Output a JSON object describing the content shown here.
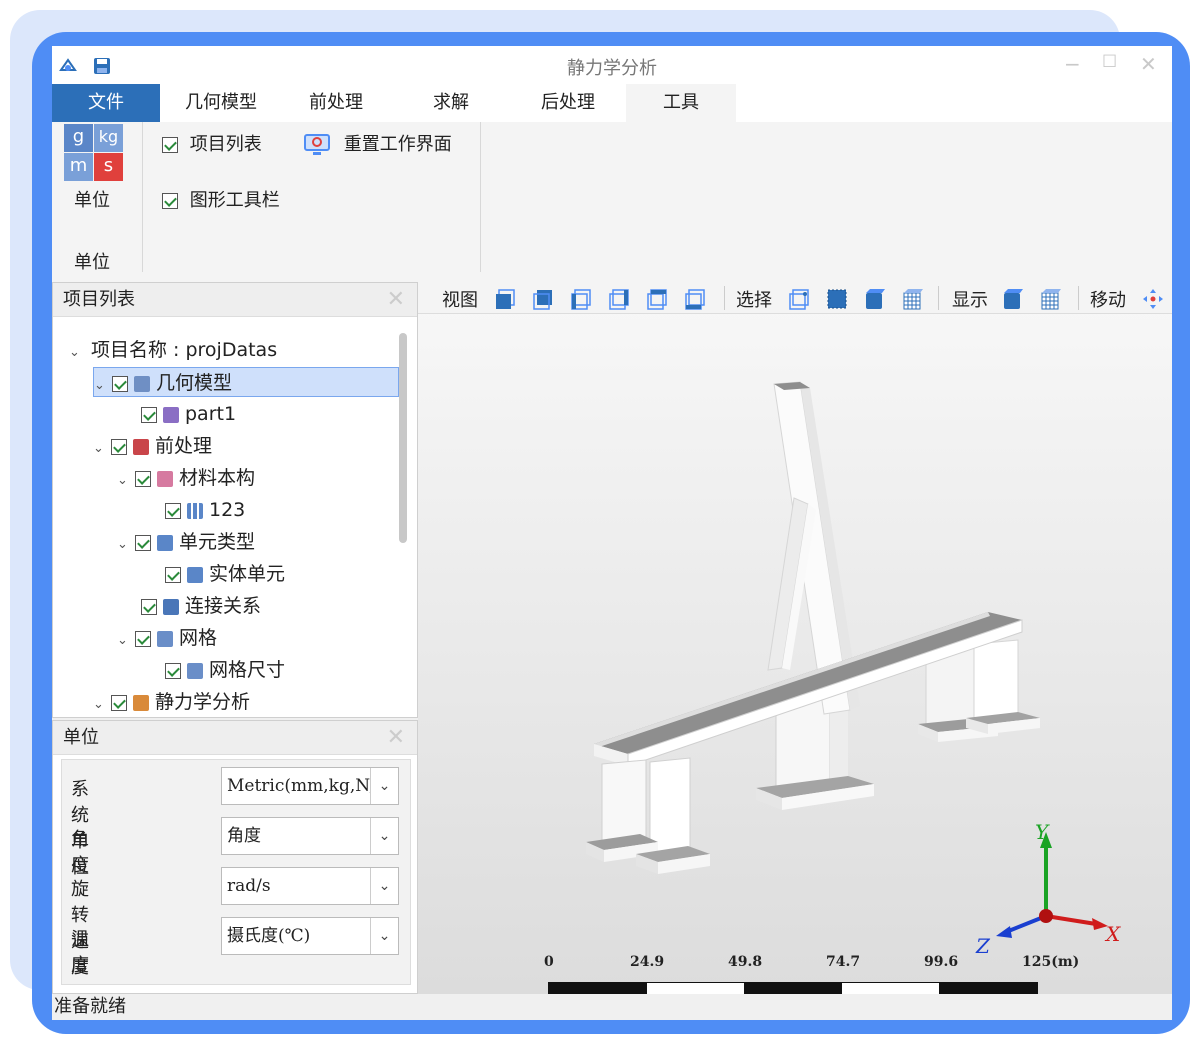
{
  "window": {
    "title": "静力学分析"
  },
  "ribbon_tabs": [
    "文件",
    "几何模型",
    "前处理",
    "求解",
    "后处理",
    "工具"
  ],
  "ribbon": {
    "units_icon_letters": [
      "g",
      "kg",
      "m",
      "s"
    ],
    "units_button_label": "单位",
    "units_group_label": "单位",
    "check_project_list": "项目列表",
    "check_graphic_toolbar": "图形工具栏",
    "reset_workspace": "重置工作界面"
  },
  "project_panel": {
    "title": "项目列表",
    "tree": [
      {
        "label": "项目名称 : projDatas"
      },
      {
        "label": "几何模型"
      },
      {
        "label": "part1"
      },
      {
        "label": "前处理"
      },
      {
        "label": "材料本构"
      },
      {
        "label": "123"
      },
      {
        "label": "单元类型"
      },
      {
        "label": "实体单元"
      },
      {
        "label": "连接关系"
      },
      {
        "label": "网格"
      },
      {
        "label": "网格尺寸"
      },
      {
        "label": "静力学分析"
      }
    ]
  },
  "units_panel": {
    "title": "单位",
    "rows": [
      {
        "label": "系统单位",
        "value": "Metric(mm,kg,N,s"
      },
      {
        "label": "角度",
        "value": "角度"
      },
      {
        "label": "旋转速度",
        "value": "rad/s"
      },
      {
        "label": "温度",
        "value": "摄氏度(℃)"
      }
    ]
  },
  "view_toolbar": {
    "view_label": "视图",
    "select_label": "选择",
    "display_label": "显示",
    "move_label": "移动"
  },
  "axes": {
    "x": "X",
    "y": "Y",
    "z": "Z"
  },
  "scale_bar": {
    "labels": [
      "0",
      "24.9",
      "49.8",
      "74.7",
      "99.6",
      "125(m)"
    ]
  },
  "status": {
    "text": "准备就绪"
  },
  "colors": {
    "accent": "#4f8df5",
    "file_tab": "#2c6fb8",
    "selection": "#cfe0fb"
  }
}
